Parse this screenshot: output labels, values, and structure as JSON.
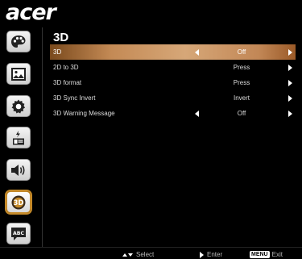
{
  "brand": {
    "logo_text": "acer"
  },
  "sidebar": {
    "items": [
      {
        "name": "palette-icon",
        "active": false
      },
      {
        "name": "image-icon",
        "active": false
      },
      {
        "name": "settings-icon",
        "active": false
      },
      {
        "name": "power-management-icon",
        "active": false
      },
      {
        "name": "audio-icon",
        "active": false
      },
      {
        "name": "3d-icon",
        "active": true,
        "label": "3D"
      },
      {
        "name": "language-icon",
        "active": false,
        "label": "ABC"
      }
    ]
  },
  "page": {
    "title": "3D"
  },
  "menu": {
    "rows": [
      {
        "label": "3D",
        "value": "Off",
        "left_arrow": true,
        "right_arrow": true,
        "selected": true
      },
      {
        "label": "2D to 3D",
        "value": "Press",
        "left_arrow": false,
        "right_arrow": true,
        "selected": false
      },
      {
        "label": "3D format",
        "value": "Press",
        "left_arrow": false,
        "right_arrow": true,
        "selected": false
      },
      {
        "label": "3D Sync Invert",
        "value": "Invert",
        "left_arrow": false,
        "right_arrow": true,
        "selected": false
      },
      {
        "label": "3D Warning Message",
        "value": "Off",
        "left_arrow": true,
        "right_arrow": true,
        "selected": false
      }
    ]
  },
  "footer": {
    "select_label": "Select",
    "enter_label": "Enter",
    "menu_key": "MENU",
    "exit_label": "Exit"
  },
  "colors": {
    "selected_row": "#c48a55",
    "active_icon_ring": "#c58a2a"
  }
}
